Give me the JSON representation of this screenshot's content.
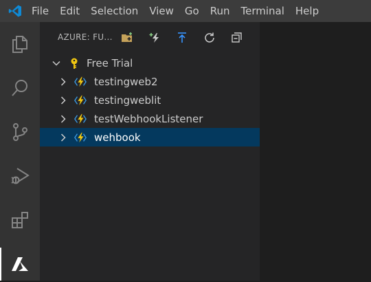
{
  "menubar": {
    "items": [
      "File",
      "Edit",
      "Selection",
      "View",
      "Go",
      "Run",
      "Terminal",
      "Help"
    ]
  },
  "activitybar": {
    "items": [
      {
        "icon": "files-icon"
      },
      {
        "icon": "search-icon"
      },
      {
        "icon": "source-control-icon"
      },
      {
        "icon": "run-debug-icon"
      },
      {
        "icon": "extensions-icon"
      },
      {
        "icon": "azure-icon",
        "active": true
      }
    ]
  },
  "sidebar": {
    "title": "AZURE: FU...",
    "actions": [
      "new-project-icon",
      "create-function-icon",
      "deploy-icon",
      "refresh-icon",
      "collapse-all-icon"
    ],
    "subscription": "Free Trial",
    "apps": [
      {
        "label": "testingweb2"
      },
      {
        "label": "testingweblit"
      },
      {
        "label": "testWebhookListener"
      },
      {
        "label": "wehbook",
        "selected": true
      }
    ]
  },
  "colors": {
    "menubar": "#3c3c3c",
    "activitybar": "#333333",
    "sidebar": "#252526",
    "editor": "#1e1e1e",
    "selection": "#04395e",
    "lightning": "#f2c811",
    "lightning_blue": "#3a96dd",
    "key": "#f2c811"
  }
}
